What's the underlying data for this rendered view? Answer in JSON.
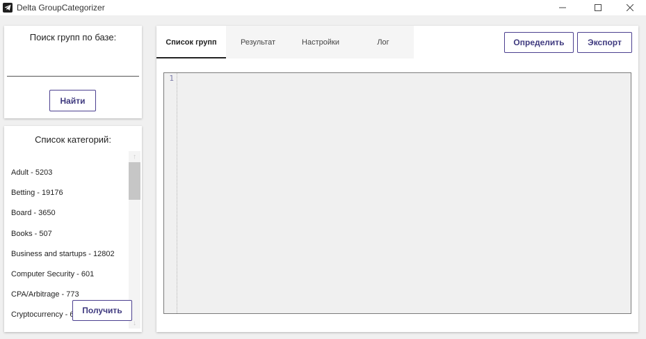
{
  "window": {
    "title": "Delta GroupCategorizer"
  },
  "search": {
    "heading": "Поиск групп по базе:",
    "input_value": "",
    "find_label": "Найти"
  },
  "categories": {
    "heading": "Список категорий:",
    "items": [
      "Adult - 5203",
      "Betting - 19176",
      "Board - 3650",
      "Books - 507",
      "Business and startups - 12802",
      "Computer Security - 601",
      "CPA/Arbitrage - 773",
      "Cryptocurrency - 6"
    ],
    "get_label": "Получить"
  },
  "main": {
    "tabs": [
      "Список групп",
      "Результат",
      "Настройки",
      "Лог"
    ],
    "active_tab": "Список групп",
    "detect_label": "Определить",
    "export_label": "Экспорт",
    "editor": {
      "line_numbers": [
        "1"
      ],
      "content": ""
    }
  },
  "colors": {
    "accent_border": "#4b3f8f",
    "button_text": "#3f3a7f",
    "editor_bg": "#f0f0f0"
  }
}
